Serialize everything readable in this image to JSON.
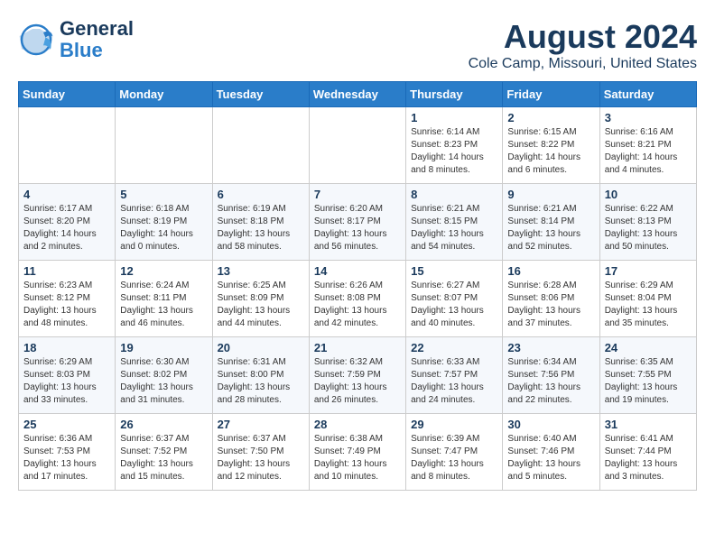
{
  "header": {
    "logo_line1": "General",
    "logo_line2": "Blue",
    "title": "August 2024",
    "subtitle": "Cole Camp, Missouri, United States"
  },
  "weekdays": [
    "Sunday",
    "Monday",
    "Tuesday",
    "Wednesday",
    "Thursday",
    "Friday",
    "Saturday"
  ],
  "weeks": [
    [
      {
        "day": "",
        "info": ""
      },
      {
        "day": "",
        "info": ""
      },
      {
        "day": "",
        "info": ""
      },
      {
        "day": "",
        "info": ""
      },
      {
        "day": "1",
        "info": "Sunrise: 6:14 AM\nSunset: 8:23 PM\nDaylight: 14 hours\nand 8 minutes."
      },
      {
        "day": "2",
        "info": "Sunrise: 6:15 AM\nSunset: 8:22 PM\nDaylight: 14 hours\nand 6 minutes."
      },
      {
        "day": "3",
        "info": "Sunrise: 6:16 AM\nSunset: 8:21 PM\nDaylight: 14 hours\nand 4 minutes."
      }
    ],
    [
      {
        "day": "4",
        "info": "Sunrise: 6:17 AM\nSunset: 8:20 PM\nDaylight: 14 hours\nand 2 minutes."
      },
      {
        "day": "5",
        "info": "Sunrise: 6:18 AM\nSunset: 8:19 PM\nDaylight: 14 hours\nand 0 minutes."
      },
      {
        "day": "6",
        "info": "Sunrise: 6:19 AM\nSunset: 8:18 PM\nDaylight: 13 hours\nand 58 minutes."
      },
      {
        "day": "7",
        "info": "Sunrise: 6:20 AM\nSunset: 8:17 PM\nDaylight: 13 hours\nand 56 minutes."
      },
      {
        "day": "8",
        "info": "Sunrise: 6:21 AM\nSunset: 8:15 PM\nDaylight: 13 hours\nand 54 minutes."
      },
      {
        "day": "9",
        "info": "Sunrise: 6:21 AM\nSunset: 8:14 PM\nDaylight: 13 hours\nand 52 minutes."
      },
      {
        "day": "10",
        "info": "Sunrise: 6:22 AM\nSunset: 8:13 PM\nDaylight: 13 hours\nand 50 minutes."
      }
    ],
    [
      {
        "day": "11",
        "info": "Sunrise: 6:23 AM\nSunset: 8:12 PM\nDaylight: 13 hours\nand 48 minutes."
      },
      {
        "day": "12",
        "info": "Sunrise: 6:24 AM\nSunset: 8:11 PM\nDaylight: 13 hours\nand 46 minutes."
      },
      {
        "day": "13",
        "info": "Sunrise: 6:25 AM\nSunset: 8:09 PM\nDaylight: 13 hours\nand 44 minutes."
      },
      {
        "day": "14",
        "info": "Sunrise: 6:26 AM\nSunset: 8:08 PM\nDaylight: 13 hours\nand 42 minutes."
      },
      {
        "day": "15",
        "info": "Sunrise: 6:27 AM\nSunset: 8:07 PM\nDaylight: 13 hours\nand 40 minutes."
      },
      {
        "day": "16",
        "info": "Sunrise: 6:28 AM\nSunset: 8:06 PM\nDaylight: 13 hours\nand 37 minutes."
      },
      {
        "day": "17",
        "info": "Sunrise: 6:29 AM\nSunset: 8:04 PM\nDaylight: 13 hours\nand 35 minutes."
      }
    ],
    [
      {
        "day": "18",
        "info": "Sunrise: 6:29 AM\nSunset: 8:03 PM\nDaylight: 13 hours\nand 33 minutes."
      },
      {
        "day": "19",
        "info": "Sunrise: 6:30 AM\nSunset: 8:02 PM\nDaylight: 13 hours\nand 31 minutes."
      },
      {
        "day": "20",
        "info": "Sunrise: 6:31 AM\nSunset: 8:00 PM\nDaylight: 13 hours\nand 28 minutes."
      },
      {
        "day": "21",
        "info": "Sunrise: 6:32 AM\nSunset: 7:59 PM\nDaylight: 13 hours\nand 26 minutes."
      },
      {
        "day": "22",
        "info": "Sunrise: 6:33 AM\nSunset: 7:57 PM\nDaylight: 13 hours\nand 24 minutes."
      },
      {
        "day": "23",
        "info": "Sunrise: 6:34 AM\nSunset: 7:56 PM\nDaylight: 13 hours\nand 22 minutes."
      },
      {
        "day": "24",
        "info": "Sunrise: 6:35 AM\nSunset: 7:55 PM\nDaylight: 13 hours\nand 19 minutes."
      }
    ],
    [
      {
        "day": "25",
        "info": "Sunrise: 6:36 AM\nSunset: 7:53 PM\nDaylight: 13 hours\nand 17 minutes."
      },
      {
        "day": "26",
        "info": "Sunrise: 6:37 AM\nSunset: 7:52 PM\nDaylight: 13 hours\nand 15 minutes."
      },
      {
        "day": "27",
        "info": "Sunrise: 6:37 AM\nSunset: 7:50 PM\nDaylight: 13 hours\nand 12 minutes."
      },
      {
        "day": "28",
        "info": "Sunrise: 6:38 AM\nSunset: 7:49 PM\nDaylight: 13 hours\nand 10 minutes."
      },
      {
        "day": "29",
        "info": "Sunrise: 6:39 AM\nSunset: 7:47 PM\nDaylight: 13 hours\nand 8 minutes."
      },
      {
        "day": "30",
        "info": "Sunrise: 6:40 AM\nSunset: 7:46 PM\nDaylight: 13 hours\nand 5 minutes."
      },
      {
        "day": "31",
        "info": "Sunrise: 6:41 AM\nSunset: 7:44 PM\nDaylight: 13 hours\nand 3 minutes."
      }
    ]
  ]
}
